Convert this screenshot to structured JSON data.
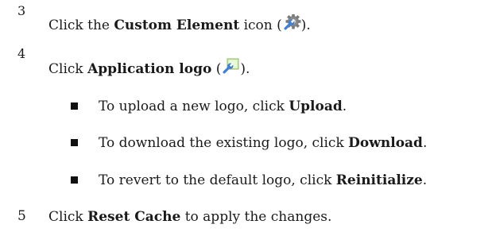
{
  "steps": [
    {
      "number": "3",
      "prefix": "Click the ",
      "bold": "Custom Element",
      "suffix": " icon (",
      "icon": "gear-wrench-icon",
      "end": ")."
    },
    {
      "number": "4",
      "prefix": "Click ",
      "bold": "Application logo",
      "suffix": " (",
      "icon": "image-wrench-icon",
      "end": ")."
    },
    {
      "number": "5",
      "prefix": "Click ",
      "bold": "Reset Cache",
      "suffix": " to apply the changes."
    }
  ],
  "bullets": [
    {
      "prefix": "To upload a new logo, click ",
      "bold": "Upload",
      "suffix": "."
    },
    {
      "prefix": "To download the existing logo, click ",
      "bold": "Download",
      "suffix": "."
    },
    {
      "prefix": "To revert to the default logo, click ",
      "bold": "Reinitialize",
      "suffix": "."
    }
  ]
}
